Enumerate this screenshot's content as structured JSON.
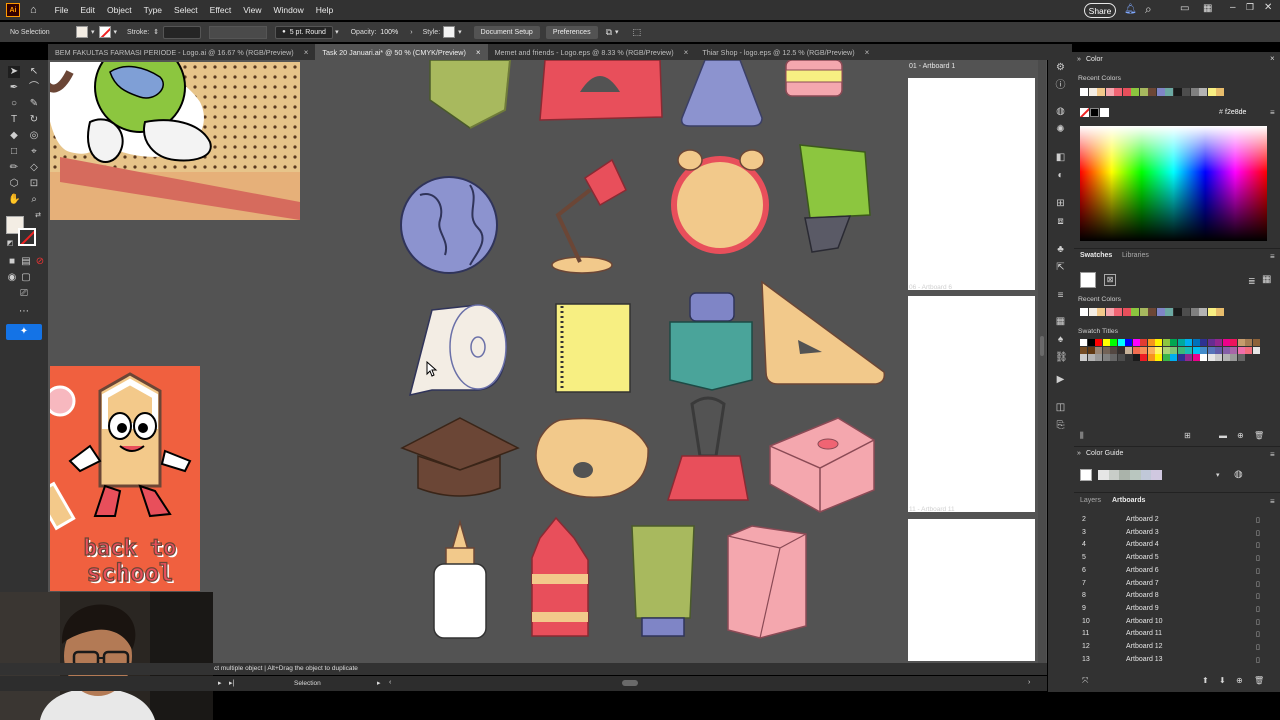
{
  "menubar": {
    "app_logo": "Ai",
    "menus": [
      "File",
      "Edit",
      "Object",
      "Type",
      "Select",
      "Effect",
      "View",
      "Window",
      "Help"
    ],
    "share_label": "Share"
  },
  "controlbar": {
    "selection_label": "No Selection",
    "stroke_label": "Stroke:",
    "brush_value": "5 pt. Round",
    "opacity_label": "Opacity:",
    "opacity_value": "100%",
    "style_label": "Style:",
    "document_setup_label": "Document Setup",
    "preferences_label": "Preferences"
  },
  "tabs": [
    {
      "label": "BEM FAKULTAS FARMASI PERIODE - Logo.ai @ 16.67 % (RGB/Preview)",
      "active": false
    },
    {
      "label": "Task 20 Januari.ai* @ 50 % (CMYK/Preview)",
      "active": true
    },
    {
      "label": "Memet and friends - Logo.eps @ 8.33 % (RGB/Preview)",
      "active": false
    },
    {
      "label": "Thiar Shop - logo.eps @ 12.5 % (RGB/Preview)",
      "active": false
    }
  ],
  "canvas": {
    "artboard_top_label": "01 - Artboard 1",
    "artboard_faded_1": "06 - Artboard 6",
    "artboard_faded_2": "11 - Artboard 11",
    "sticker_text_line1": "back to",
    "sticker_text_line2": "school"
  },
  "statusbar": {
    "hint": "ct multiple object  |  Alt+Drag the object to duplicate",
    "mode": "Selection"
  },
  "color_panel": {
    "title": "Color",
    "recent_label": "Recent Colors",
    "hex_prefix": "#",
    "hex_value": "f2e8de",
    "recent_colors": [
      "#ffffff",
      "#f3ede4",
      "#f2c98b",
      "#f4a7ae",
      "#f06473",
      "#e84f5b",
      "#8cc63f",
      "#a7b85f",
      "#6b4636",
      "#7f85c6",
      "#6ca9a3",
      "#1a1a1a",
      "#4d4d4d",
      "#808080",
      "#b3b3b3",
      "#f7ef82",
      "#e8bd6c"
    ]
  },
  "swatches_panel": {
    "tab_swatches": "Swatches",
    "tab_libraries": "Libraries",
    "recent_label": "Recent Colors",
    "swatch_titles_label": "Swatch Titles",
    "recent_colors": [
      "#ffffff",
      "#f3ede4",
      "#f2c98b",
      "#f4a7ae",
      "#f06473",
      "#e84f5b",
      "#8cc63f",
      "#a7b85f",
      "#6b4636",
      "#7f85c6",
      "#6ca9a3",
      "#1a1a1a",
      "#4d4d4d",
      "#808080",
      "#b3b3b3",
      "#f7ef82",
      "#e8bd6c"
    ],
    "grid_colors": [
      "#ffffff",
      "#000000",
      "#ff0000",
      "#ffff00",
      "#00ff00",
      "#00ffff",
      "#0000ff",
      "#ff00ff",
      "#e03c31",
      "#f7941d",
      "#fff200",
      "#8dc63f",
      "#00a651",
      "#00a99d",
      "#00aeef",
      "#0072bc",
      "#2e3192",
      "#662d91",
      "#92278f",
      "#ec008c",
      "#ed145b",
      "#c69c6d",
      "#a67c52",
      "#8c6239",
      "#754c24",
      "#603913",
      "#998675",
      "#736357",
      "#534741",
      "#362f2d",
      "#c7b299",
      "#f26c4f",
      "#f68e56",
      "#fbaf5d",
      "#fff568",
      "#acd373",
      "#7cc576",
      "#3bb878",
      "#1abbb4",
      "#00bff3",
      "#448ccb",
      "#5674b9",
      "#605ca8",
      "#855fa8",
      "#a864a8",
      "#f06eaa",
      "#f26d7d",
      "#e6e6e6",
      "#cccccc",
      "#b3b3b3",
      "#999999",
      "#808080",
      "#666666",
      "#4d4d4d",
      "#333333",
      "#1a1a1a",
      "#ed1c24",
      "#f7941d",
      "#fff200",
      "#39b54a",
      "#00aeef",
      "#2e3192",
      "#92278f",
      "#ec008c",
      "#ffffff",
      "#e6e6e6",
      "#cccccc",
      "#b3b3b3",
      "#999999",
      "#666666"
    ]
  },
  "color_guide_panel": {
    "title": "Color Guide"
  },
  "layers_panel": {
    "tab_layers": "Layers",
    "tab_artboards": "Artboards",
    "rows": [
      {
        "num": "2",
        "name": "Artboard 2"
      },
      {
        "num": "3",
        "name": "Artboard 3"
      },
      {
        "num": "4",
        "name": "Artboard 4"
      },
      {
        "num": "5",
        "name": "Artboard 5"
      },
      {
        "num": "6",
        "name": "Artboard 6"
      },
      {
        "num": "7",
        "name": "Artboard 7"
      },
      {
        "num": "8",
        "name": "Artboard 8"
      },
      {
        "num": "9",
        "name": "Artboard 9"
      },
      {
        "num": "10",
        "name": "Artboard 10"
      },
      {
        "num": "11",
        "name": "Artboard 11"
      },
      {
        "num": "12",
        "name": "Artboard 12"
      },
      {
        "num": "13",
        "name": "Artboard 13"
      }
    ]
  },
  "icons": {
    "home": "home-icon",
    "search": "search-icon",
    "bell": "bell-icon",
    "window_min": "minimize-icon",
    "window_max": "maximize-icon",
    "window_close": "close-icon"
  }
}
